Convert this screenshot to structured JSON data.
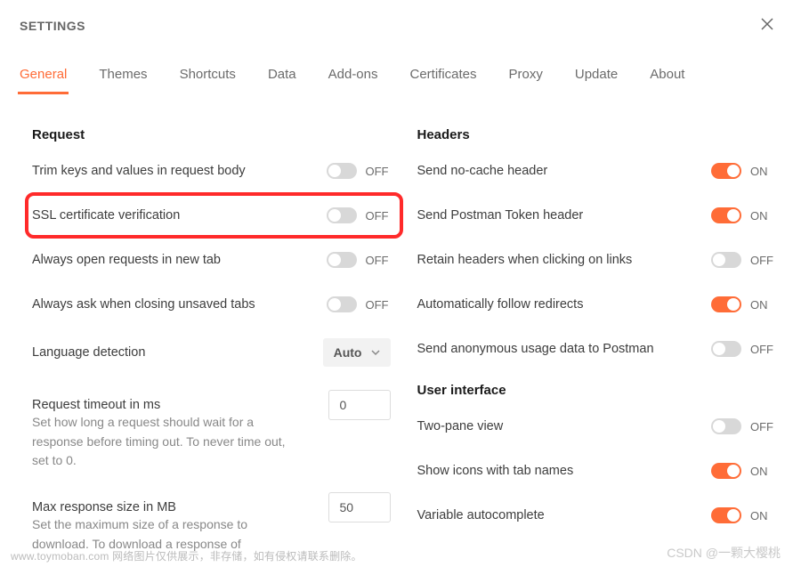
{
  "header": {
    "title": "SETTINGS"
  },
  "tabs": [
    "General",
    "Themes",
    "Shortcuts",
    "Data",
    "Add-ons",
    "Certificates",
    "Proxy",
    "Update",
    "About"
  ],
  "active_tab": 0,
  "sections": {
    "request": {
      "title": "Request",
      "items": {
        "trim_keys": {
          "label": "Trim keys and values in request body",
          "state": "OFF"
        },
        "ssl_verify": {
          "label": "SSL certificate verification",
          "state": "OFF"
        },
        "open_new_tab": {
          "label": "Always open requests in new tab",
          "state": "OFF"
        },
        "ask_close": {
          "label": "Always ask when closing unsaved tabs",
          "state": "OFF"
        },
        "lang_detect": {
          "label": "Language detection",
          "value": "Auto"
        },
        "timeout": {
          "label": "Request timeout in ms",
          "value": "0",
          "help": "Set how long a request should wait for a response before timing out. To never time out, set to 0."
        },
        "max_resp": {
          "label": "Max response size in MB",
          "value": "50",
          "help": "Set the maximum size of a response to download. To download a response of"
        }
      }
    },
    "headers": {
      "title": "Headers",
      "items": {
        "no_cache": {
          "label": "Send no-cache header",
          "state": "ON"
        },
        "pm_token": {
          "label": "Send Postman Token header",
          "state": "ON"
        },
        "retain": {
          "label": "Retain headers when clicking on links",
          "state": "OFF"
        },
        "redirects": {
          "label": "Automatically follow redirects",
          "state": "ON"
        },
        "anon_usage": {
          "label": "Send anonymous usage data to Postman",
          "state": "OFF"
        }
      }
    },
    "ui": {
      "title": "User interface",
      "items": {
        "two_pane": {
          "label": "Two-pane view",
          "state": "OFF"
        },
        "tab_icons": {
          "label": "Show icons with tab names",
          "state": "ON"
        },
        "autocomplete": {
          "label": "Variable autocomplete",
          "state": "ON"
        }
      }
    }
  },
  "watermark1": "www.toymoban.com 网络图片仅供展示，非存储，如有侵权请联系删除。",
  "watermark2": "CSDN @一颗大樱桃"
}
